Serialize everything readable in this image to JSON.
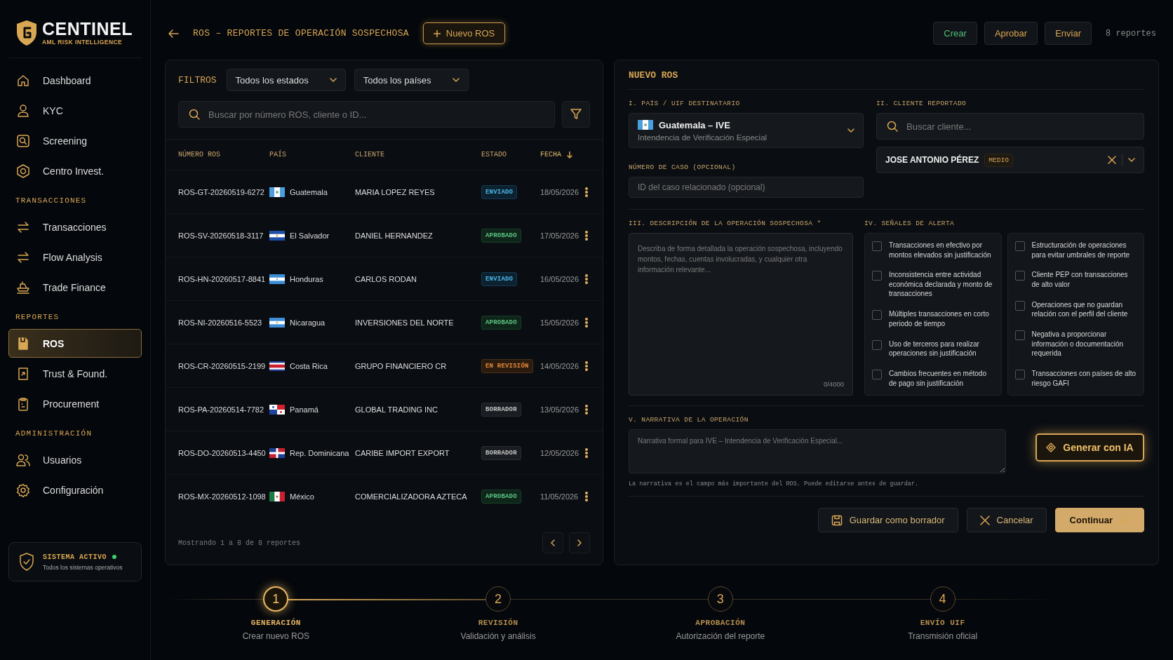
{
  "brand": {
    "name": "CENTINEL",
    "tagline": "AML RISK INTELLIGENCE"
  },
  "sidebar": {
    "sections": [
      {
        "items": [
          {
            "label": "Dashboard",
            "selected": false
          },
          {
            "label": "KYC",
            "selected": false
          },
          {
            "label": "Screening",
            "selected": false
          },
          {
            "label": "Centro Invest.",
            "selected": false
          }
        ]
      },
      {
        "heading": "TRANSACCIONES",
        "items": [
          {
            "label": "Transacciones",
            "selected": false
          },
          {
            "label": "Flow Analysis",
            "selected": false
          },
          {
            "label": "Trade Finance",
            "selected": false
          }
        ]
      },
      {
        "heading": "REPORTES",
        "items": [
          {
            "label": "ROS",
            "selected": true
          },
          {
            "label": "Trust & Found.",
            "selected": false
          },
          {
            "label": "Procurement",
            "selected": false
          }
        ]
      },
      {
        "heading": "ADMINISTRACIÓN",
        "items": [
          {
            "label": "Usuarios",
            "selected": false
          },
          {
            "label": "Configuración",
            "selected": false
          }
        ]
      }
    ],
    "status": {
      "title": "SISTEMA ACTIVO",
      "subtitle": "Todos los sistemas operativos",
      "on": true
    }
  },
  "topbar": {
    "title": "ROS – REPORTES DE OPERACIÓN SOSPECHOSA",
    "new_button": "Nuevo ROS",
    "actions": [
      {
        "label": "Crear",
        "color": "#4fbf7a"
      },
      {
        "label": "Aprobar",
        "color": "#d9a654"
      },
      {
        "label": "Enviar",
        "color": "#d9a654"
      }
    ],
    "count": "8 reportes"
  },
  "filters": {
    "label": "FILTROS",
    "dropdowns": [
      "Todos los estados",
      "Todos los países"
    ],
    "search_placeholder": "Buscar por número ROS, cliente o ID..."
  },
  "table": {
    "columns": [
      {
        "label": "NÚMERO ROS",
        "sorted": false
      },
      {
        "label": "PAÍS",
        "sorted": false
      },
      {
        "label": "CLIENTE",
        "sorted": false
      },
      {
        "label": "ESTADO",
        "sorted": false
      },
      {
        "label": "FECHA",
        "sorted": true
      }
    ],
    "rows": [
      {
        "number": "ROS-GT-20260519-6272",
        "country": "Guatemala",
        "client": "MARIA LOPEZ REYES",
        "status": "ENVIADO",
        "kind": "sent",
        "date": "18/05/2026"
      },
      {
        "number": "ROS-SV-20260518-3117",
        "country": "El Salvador",
        "client": "DANIEL HERNANDEZ",
        "status": "APROBADO",
        "kind": "approved",
        "date": "17/05/2026"
      },
      {
        "number": "ROS-HN-20260517-8841",
        "country": "Honduras",
        "client": "CARLOS RODAN",
        "status": "ENVIADO",
        "kind": "sent",
        "date": "16/05/2026"
      },
      {
        "number": "ROS-NI-20260516-5523",
        "country": "Nicaragua",
        "client": "INVERSIONES DEL NORTE",
        "status": "APROBADO",
        "kind": "approved",
        "date": "15/05/2026"
      },
      {
        "number": "ROS-CR-20260515-2199",
        "country": "Costa Rica",
        "client": "GRUPO FINANCIERO CR",
        "status": "EN REVISIÓN",
        "kind": "review",
        "date": "14/05/2026"
      },
      {
        "number": "ROS-PA-20260514-7782",
        "country": "Panamá",
        "client": "GLOBAL TRADING INC",
        "status": "BORRADOR",
        "kind": "draft",
        "date": "13/05/2026"
      },
      {
        "number": "ROS-DO-20260513-4450",
        "country": "Rep. Dominicana",
        "client": "CARIBE IMPORT EXPORT",
        "status": "BORRADOR",
        "kind": "draft",
        "date": "12/05/2026"
      },
      {
        "number": "ROS-MX-20260512-1098",
        "country": "México",
        "client": "COMERCIALIZADORA AZTECA",
        "status": "APROBADO",
        "kind": "approved",
        "date": "11/05/2026"
      }
    ],
    "footer": "Mostrando 1 a 8 de 8 reportes"
  },
  "form": {
    "title": "NUEVO ROS",
    "country": {
      "label": "I. PAÍS / UIF DESTINATARIO",
      "value": "Guatemala – IVE",
      "subtitle": "Intendencia de Verificación Especial"
    },
    "case": {
      "label": "NÚMERO DE CASO (OPCIONAL)",
      "placeholder": "ID del caso relacionado (opcional)"
    },
    "client": {
      "label": "II. CLIENTE REPORTADO",
      "placeholder": "Buscar cliente...",
      "selected_name": "JOSE ANTONIO PÉREZ",
      "risk": "MEDIO"
    },
    "description": {
      "label": "III. DESCRIPCIÓN DE LA OPERACIÓN SOSPECHOSA *",
      "placeholder": "Describa de forma detallada la operación sospechosa, incluyendo montos, fechas, cuentas involucradas, y cualquier otra información relevante...",
      "counter": "0/4000"
    },
    "alerts": {
      "label": "IV. SEÑALES DE ALERTA",
      "columns": [
        {
          "items": [
            {
              "text": "Transacciones en efectivo por montos elevados sin justificación",
              "checked": false
            },
            {
              "text": "Inconsistencia entre actividad económica declarada y monto de transacciones",
              "checked": false
            },
            {
              "text": "Múltiples transacciones en corto periodo de tiempo",
              "checked": false
            },
            {
              "text": "Uso de terceros para realizar operaciones sin justificación",
              "checked": false
            },
            {
              "text": "Cambios frecuentes en método de pago sin justificación",
              "checked": false
            }
          ]
        },
        {
          "items": [
            {
              "text": "Estructuración de operaciones para evitar umbrales de reporte",
              "checked": false
            },
            {
              "text": "Cliente PEP con transacciones de alto valor",
              "checked": false
            },
            {
              "text": "Operaciones que no guardan relación con el perfil del cliente",
              "checked": false
            },
            {
              "text": "Negativa a proporcionar información o documentación requerida",
              "checked": false
            },
            {
              "text": "Transacciones con países de alto riesgo GAFI",
              "checked": false
            }
          ]
        }
      ]
    },
    "narrative": {
      "label": "V. NARRATIVA DE LA OPERACIÓN",
      "placeholder": "Narrativa formal para IVE – Intendencia de Verificación Especial...",
      "ai_button": "Generar con IA",
      "hint": "La narrativa es el campo más importante del ROS. Puede editarse antes de guardar."
    },
    "buttons": {
      "draft": "Guardar como borrador",
      "cancel": "Cancelar",
      "continue": "Continuar"
    }
  },
  "stepper": {
    "steps": [
      {
        "number": "1",
        "title": "GENERACIÓN",
        "subtitle": "Crear nuevo ROS",
        "active": true
      },
      {
        "number": "2",
        "title": "REVISIÓN",
        "subtitle": "Validación y análisis",
        "active": false
      },
      {
        "number": "3",
        "title": "APROBACIÓN",
        "subtitle": "Autorización del reporte",
        "active": false
      },
      {
        "number": "4",
        "title": "ENVÍO UIF",
        "subtitle": "Transmisión oficial",
        "active": false
      }
    ]
  }
}
